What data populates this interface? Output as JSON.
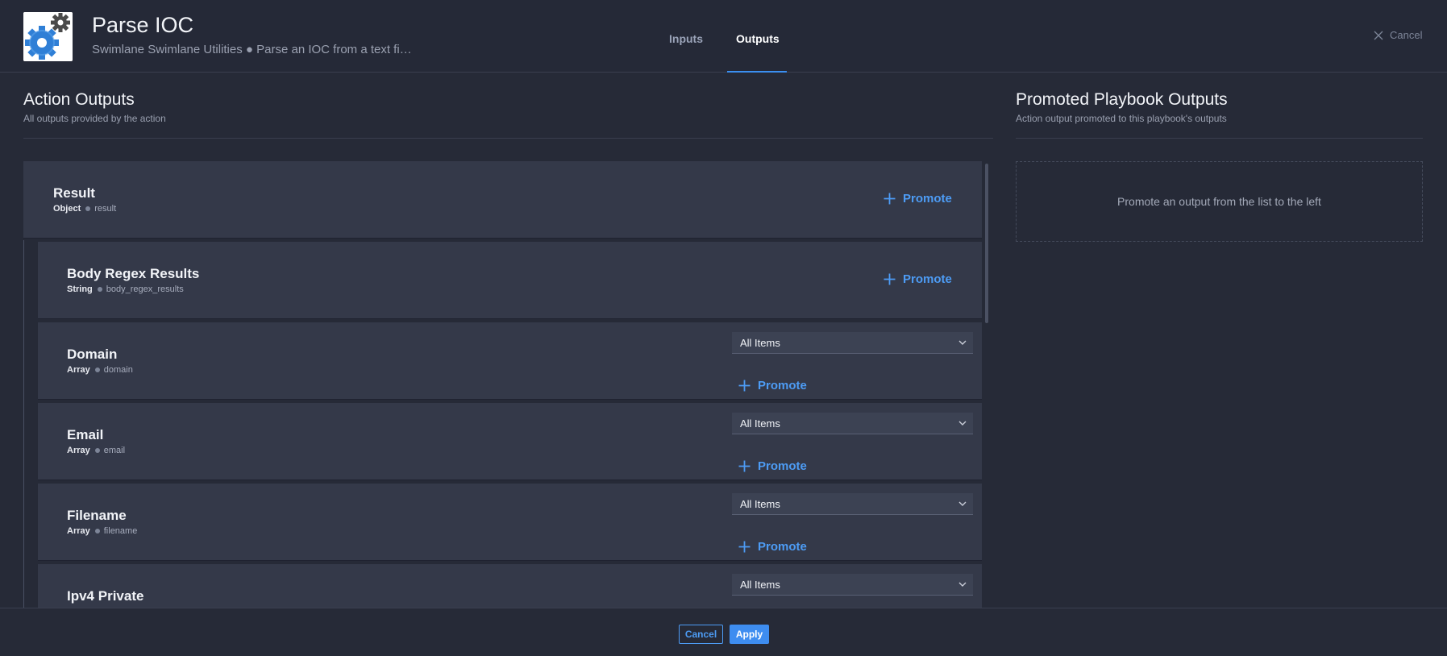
{
  "header": {
    "title": "Parse IOC",
    "subtitle": "Swimlane Swimlane Utilities ● Parse an IOC from a text fi…",
    "app_icon": "gears-icon",
    "tabs": [
      {
        "label": "Inputs",
        "active": false
      },
      {
        "label": "Outputs",
        "active": true
      }
    ],
    "cancel_label": "Cancel"
  },
  "action_outputs": {
    "title": "Action Outputs",
    "subtitle": "All outputs provided by the action",
    "items": [
      {
        "name": "Result",
        "type": "Object",
        "key": "result",
        "promote_label": "Promote"
      },
      {
        "name": "Body Regex Results",
        "type": "String",
        "key": "body_regex_results",
        "promote_label": "Promote"
      },
      {
        "name": "Domain",
        "type": "Array",
        "key": "domain",
        "select_value": "All Items",
        "promote_label": "Promote"
      },
      {
        "name": "Email",
        "type": "Array",
        "key": "email",
        "select_value": "All Items",
        "promote_label": "Promote"
      },
      {
        "name": "Filename",
        "type": "Array",
        "key": "filename",
        "select_value": "All Items",
        "promote_label": "Promote"
      },
      {
        "name": "Ipv4 Private",
        "type": "",
        "key": "",
        "select_value": "All Items",
        "promote_label": ""
      }
    ]
  },
  "promoted_outputs": {
    "title": "Promoted Playbook Outputs",
    "subtitle": "Action output promoted to this playbook's outputs",
    "empty_message": "Promote an output from the list to the left"
  },
  "footer": {
    "cancel_label": "Cancel",
    "apply_label": "Apply"
  },
  "colors": {
    "background": "#262a37",
    "card": "#343949",
    "accent": "#4d9cf5",
    "apply_button": "#3e8df0"
  }
}
